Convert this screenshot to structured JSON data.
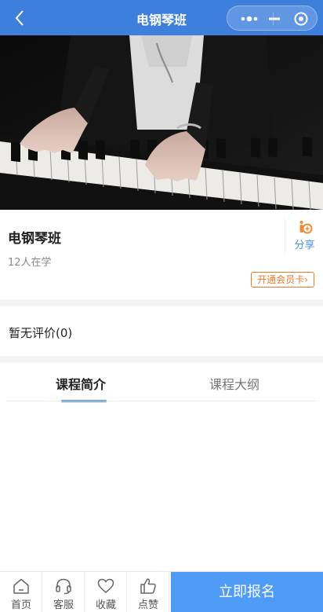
{
  "navbar": {
    "title": "电钢琴班",
    "back_icon": "chevron-left-icon",
    "more_icon": "more-dots-icon",
    "minimize_icon": "minimize-icon",
    "close_icon": "target-close-icon",
    "background": "#3f7fdc"
  },
  "hero": {
    "image": "piano-hands-photo"
  },
  "course": {
    "title": "电钢琴班",
    "learners": "12人在学",
    "share_label": "分享",
    "vip_button": "开通会员卡",
    "vip_arrow": "›"
  },
  "reviews": {
    "text": "暂无评价(0)"
  },
  "tabs": [
    {
      "label": "课程简介",
      "active": true
    },
    {
      "label": "课程大纲",
      "active": false
    }
  ],
  "bottom_bar": {
    "items": [
      {
        "label": "首页",
        "icon": "home-icon"
      },
      {
        "label": "客服",
        "icon": "headset-icon"
      },
      {
        "label": "收藏",
        "icon": "heart-icon"
      },
      {
        "label": "点赞",
        "icon": "thumbs-up-icon"
      }
    ],
    "enroll_label": "立即报名",
    "enroll_color": "#4f9cf6"
  }
}
